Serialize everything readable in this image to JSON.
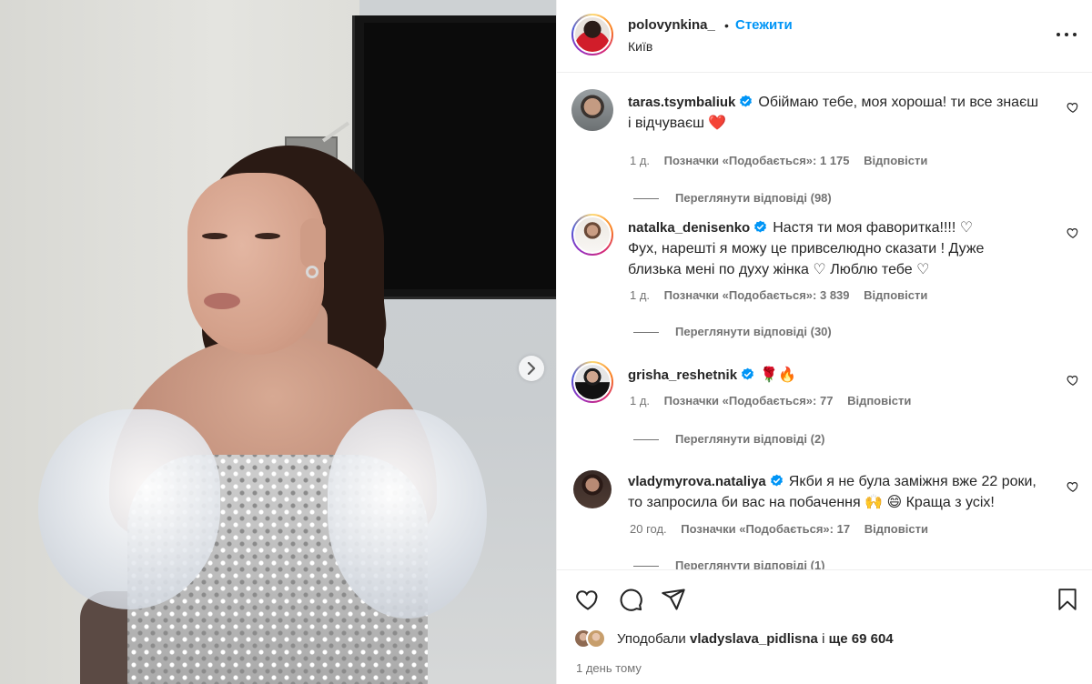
{
  "post": {
    "username": "polovynkina_",
    "separator": "•",
    "follow_label": "Стежити",
    "location": "Київ"
  },
  "comments": [
    {
      "username": "taras.tsymbaliuk",
      "text_line1": "Обіймаю тебе, моя хороша! ти все знаєш",
      "text_line2": "і відчуваєш",
      "emoji": "❤️",
      "time": "1 д.",
      "likes": "Позначки «Подобається»: 1 175",
      "reply": "Відповісти",
      "view_replies": "Переглянути відповіді (98)"
    },
    {
      "username": "natalka_denisenko",
      "text_line1": "Настя ти моя фаворитка!!!! ♡",
      "text_line2": "Фух, нарешті я можу це привселюдно сказати ! Дуже",
      "text_line3": "близька мені по духу жінка ♡ Люблю тебе ♡",
      "time": "1 д.",
      "likes": "Позначки «Подобається»: 3 839",
      "reply": "Відповісти",
      "view_replies": "Переглянути відповіді (30)"
    },
    {
      "username": "grisha_reshetnik",
      "text_line1": "🌹🔥",
      "time": "1 д.",
      "likes": "Позначки «Подобається»: 77",
      "reply": "Відповісти",
      "view_replies": "Переглянути відповіді (2)"
    },
    {
      "username": "vladymyrova.nataliya",
      "text_line1": "Якби я не була заміжня вже 22 роки,",
      "text_line2": "то запросила би вас на побачення 🙌 😄 Краща з усіх!",
      "time": "20 год.",
      "likes": "Позначки «Подобається»: 17",
      "reply": "Відповісти",
      "view_replies": "Переглянути відповіді (1)"
    }
  ],
  "actions": {
    "liked_prefix": "Уподобали",
    "liked_user": "vladyslava_pidlisna",
    "liked_middle": "і",
    "liked_count": "ще 69 604",
    "date": "1 день тому"
  },
  "icons": {
    "more": "more-options-icon",
    "like": "heart-icon",
    "comment": "comment-icon",
    "share": "share-icon",
    "save": "bookmark-icon",
    "next": "chevron-right-icon",
    "verified": "verified-badge-icon"
  },
  "colors": {
    "link_blue": "#0095f6",
    "verified_blue": "#0095f6",
    "text": "#262626",
    "secondary": "#737373",
    "divider": "#efefef"
  }
}
